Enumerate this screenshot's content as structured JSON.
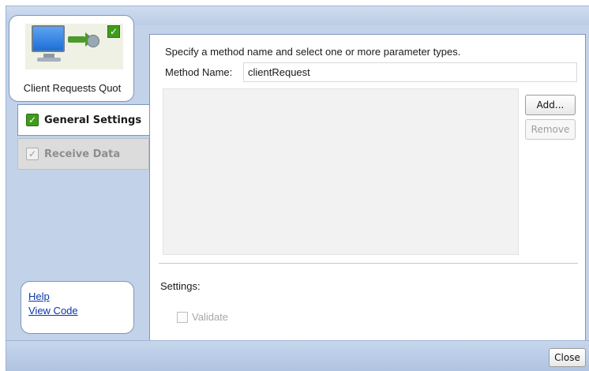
{
  "task_card": {
    "label": "Client Requests Quot",
    "icons": [
      "monitor-icon",
      "arrow-icon",
      "check-icon"
    ]
  },
  "tabs": [
    {
      "label": "General Settings",
      "state": "active",
      "checked": true
    },
    {
      "label": "Receive Data",
      "state": "inactive",
      "checked": true
    }
  ],
  "links": {
    "help": "Help",
    "view_code": "View Code"
  },
  "main": {
    "instruction": "Specify a method name and select one or more parameter types.",
    "method_name_label": "Method Name:",
    "method_name_value": "clientRequest",
    "parameter_types": [],
    "add_button": "Add...",
    "remove_button": "Remove",
    "settings_label": "Settings:",
    "validate_label": "Validate",
    "validate_checked": false
  },
  "footer": {
    "close_button": "Close"
  },
  "colors": {
    "frame_bg": "#c2d2e9",
    "panel_border": "#7f95bd",
    "check_green": "#3f9c1c",
    "link_blue": "#0a37a8"
  }
}
